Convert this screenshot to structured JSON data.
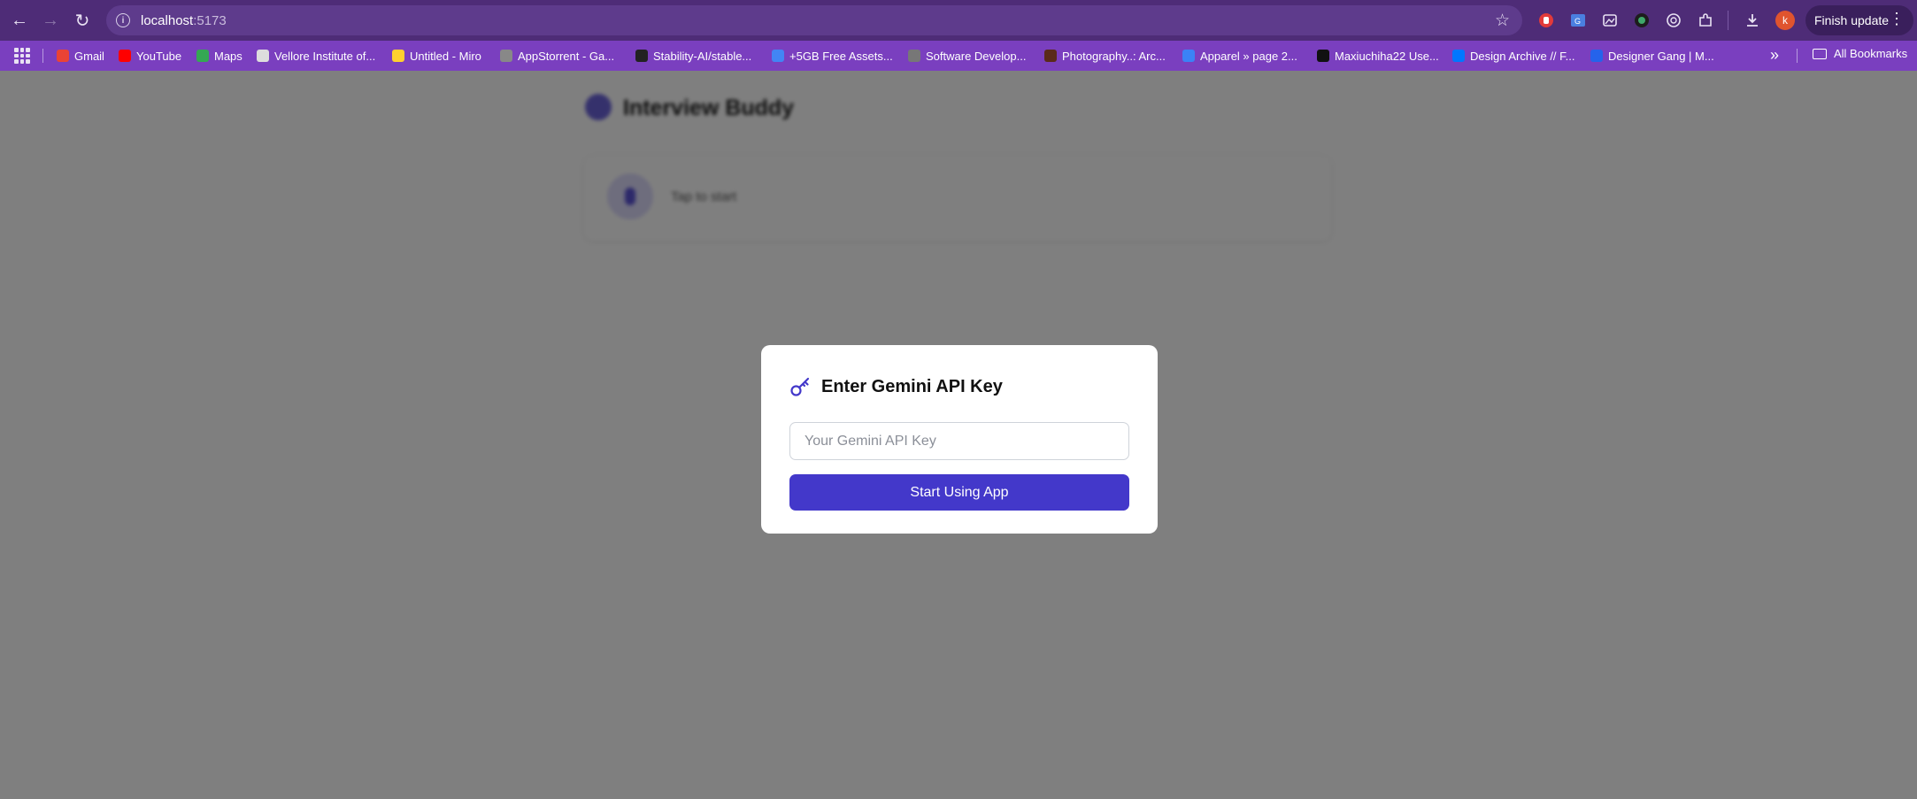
{
  "browser": {
    "url_host": "localhost",
    "url_port": ":5173",
    "finish_update_label": "Finish update",
    "avatar_letter": "k",
    "bookmarks": [
      {
        "label": "Gmail",
        "icon": "gmail-icon",
        "color": "#ea4335"
      },
      {
        "label": "YouTube",
        "icon": "youtube-icon",
        "color": "#ff0000"
      },
      {
        "label": "Maps",
        "icon": "maps-icon",
        "color": "#34a853"
      },
      {
        "label": "Vellore Institute of...",
        "icon": "vit-icon",
        "color": "#dddddd"
      },
      {
        "label": "Untitled - Miro",
        "icon": "miro-icon",
        "color": "#ffd02f"
      },
      {
        "label": "AppStorrent - Ga...",
        "icon": "appstorrent-icon",
        "color": "#888888"
      },
      {
        "label": "Stability-AI/stable...",
        "icon": "github-icon",
        "color": "#222222"
      },
      {
        "label": "+5GB Free Assets...",
        "icon": "drive-icon",
        "color": "#4285f4"
      },
      {
        "label": "Software Develop...",
        "icon": "software-icon",
        "color": "#777777"
      },
      {
        "label": "Photography..: Arc...",
        "icon": "photography-icon",
        "color": "#5a2a1a"
      },
      {
        "label": "Apparel » page 2...",
        "icon": "apparel-icon",
        "color": "#3b82f6"
      },
      {
        "label": "Maxiuchiha22 Use...",
        "icon": "maxiuchiha-icon",
        "color": "#111111"
      },
      {
        "label": "Design Archive // F...",
        "icon": "vk-icon",
        "color": "#0077ff"
      },
      {
        "label": "Designer Gang | M...",
        "icon": "designergang-icon",
        "color": "#2563eb"
      }
    ],
    "all_bookmarks_label": "All Bookmarks"
  },
  "app": {
    "title": "Interview Buddy",
    "tap_to_start": "Tap to start"
  },
  "modal": {
    "title": "Enter Gemini API Key",
    "input_placeholder": "Your Gemini API Key",
    "input_value": "",
    "button_label": "Start Using App",
    "accent_color": "#4338ca"
  }
}
